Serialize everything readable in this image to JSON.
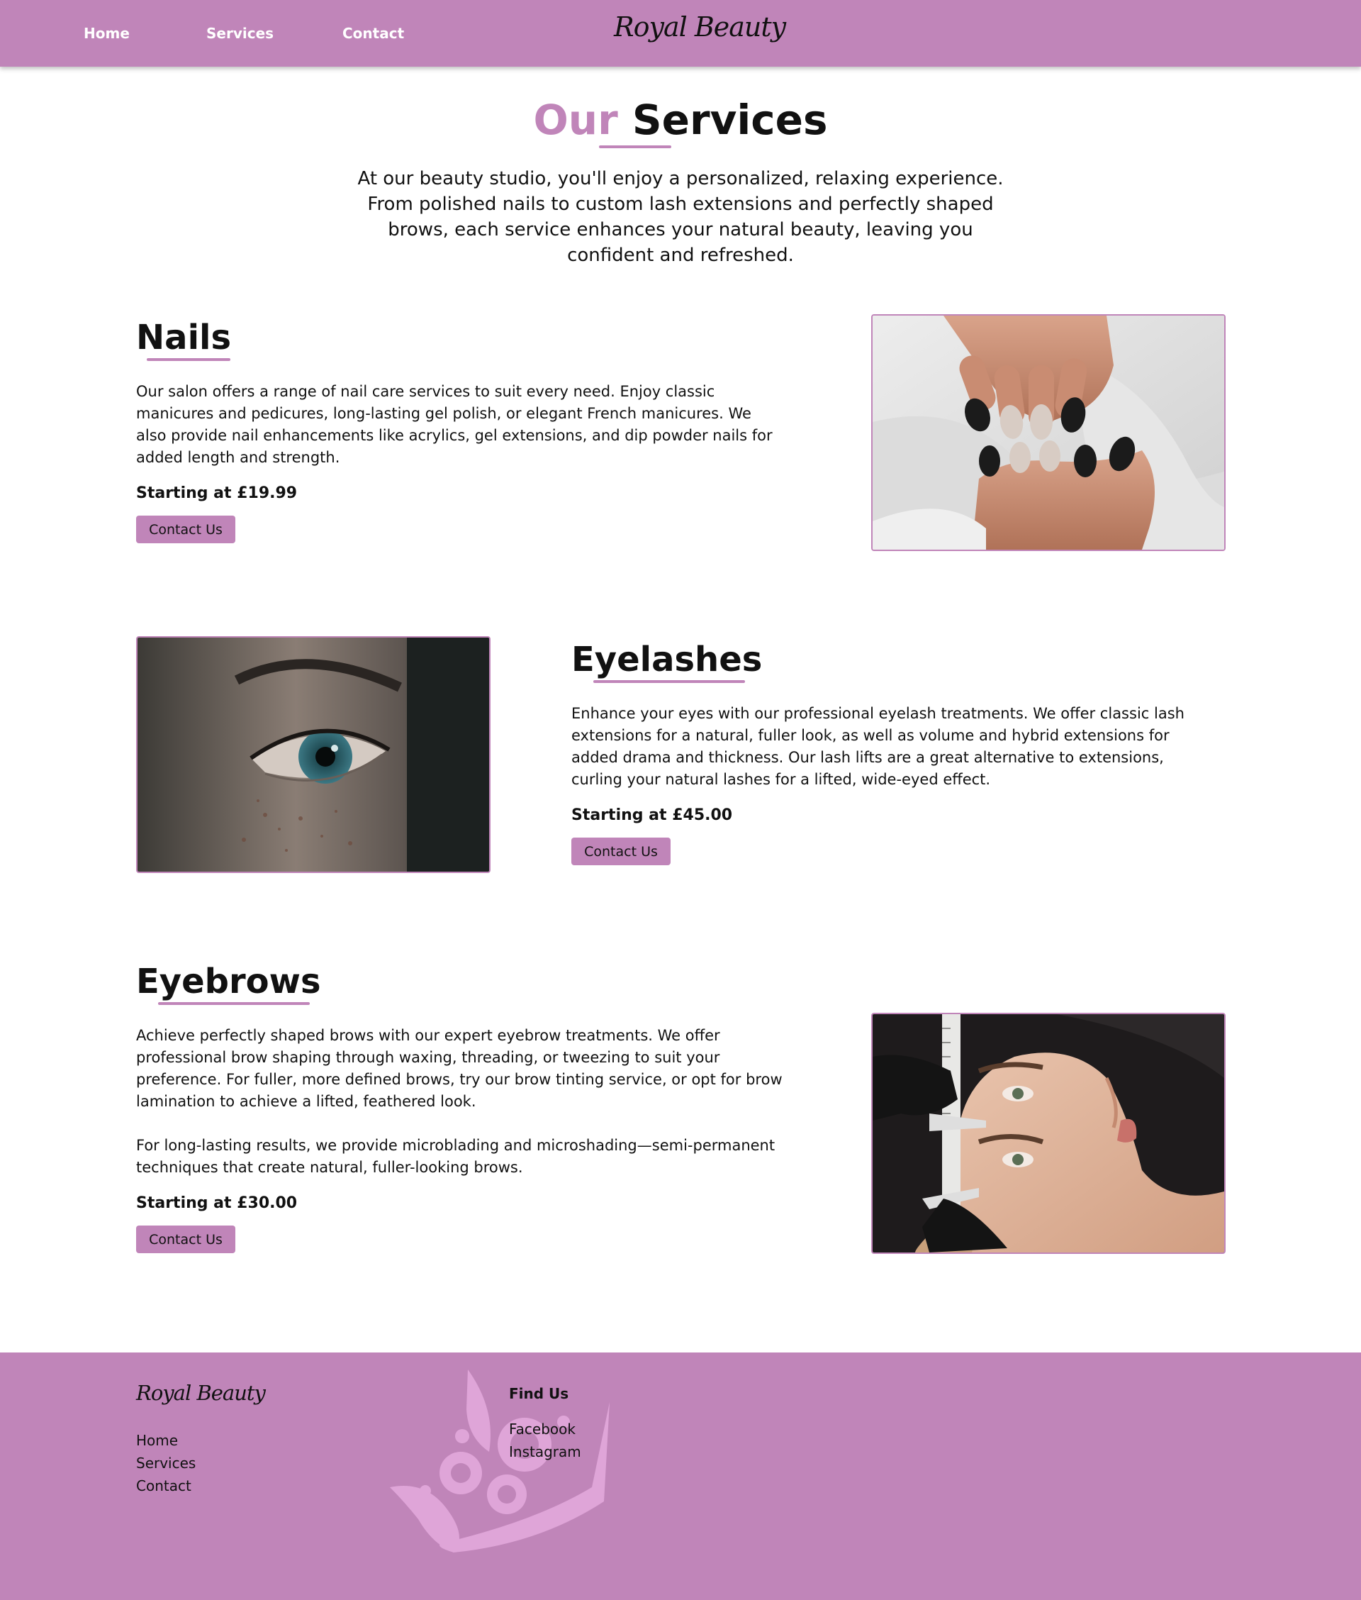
{
  "nav": {
    "links": [
      "Home",
      "Services",
      "Contact"
    ],
    "brand": "Royal Beauty"
  },
  "hero": {
    "title_accent": "Our",
    "title_main": "Services",
    "intro": "At our beauty studio, you'll enjoy a personalized, relaxing experience. From polished nails to custom lash extensions and perfectly shaped brows, each service enhances your natural beauty, leaving you confident and refreshed."
  },
  "services": [
    {
      "title": "Nails",
      "description": "Our salon offers a range of nail care services to suit every need. Enjoy classic manicures and pedicures, long-lasting gel polish, or elegant French manicures. We also provide nail enhancements like acrylics, gel extensions, and dip powder nails for added length and strength.",
      "price": "Starting at £19.99",
      "button": "Contact Us",
      "image": "manicured-hands-photo"
    },
    {
      "title": "Eyelashes",
      "description": "Enhance your eyes with our professional eyelash treatments. We offer classic lash extensions for a natural, fuller look, as well as volume and hybrid extensions for added drama and thickness. Our lash lifts are a great alternative to extensions, curling your natural lashes for a lifted, wide-eyed effect.",
      "price": "Starting at £45.00",
      "button": "Contact Us",
      "image": "eye-closeup-photo"
    },
    {
      "title": "Eyebrows",
      "description": "Achieve perfectly shaped brows with our expert eyebrow treatments. We offer professional brow shaping through waxing, threading, or tweezing to suit your preference. For fuller, more defined brows, try our brow tinting service, or opt for brow lamination to achieve a lifted, feathered look.",
      "description2": "For long-lasting results, we provide microblading and microshading—semi-permanent techniques that create natural, fuller-looking brows.",
      "price": "Starting at £30.00",
      "button": "Contact Us",
      "image": "brow-measuring-photo"
    }
  ],
  "footer": {
    "brand": "Royal Beauty",
    "links": [
      "Home",
      "Services",
      "Contact"
    ],
    "find_us_title": "Find Us",
    "social": [
      "Facebook",
      "Instagram"
    ],
    "decoration_icon": "crown-icon"
  },
  "colors": {
    "brand_purple": "#c085b9",
    "crown_light": "#dfa5d8",
    "text": "#111111",
    "nav_text": "#ffffff"
  }
}
